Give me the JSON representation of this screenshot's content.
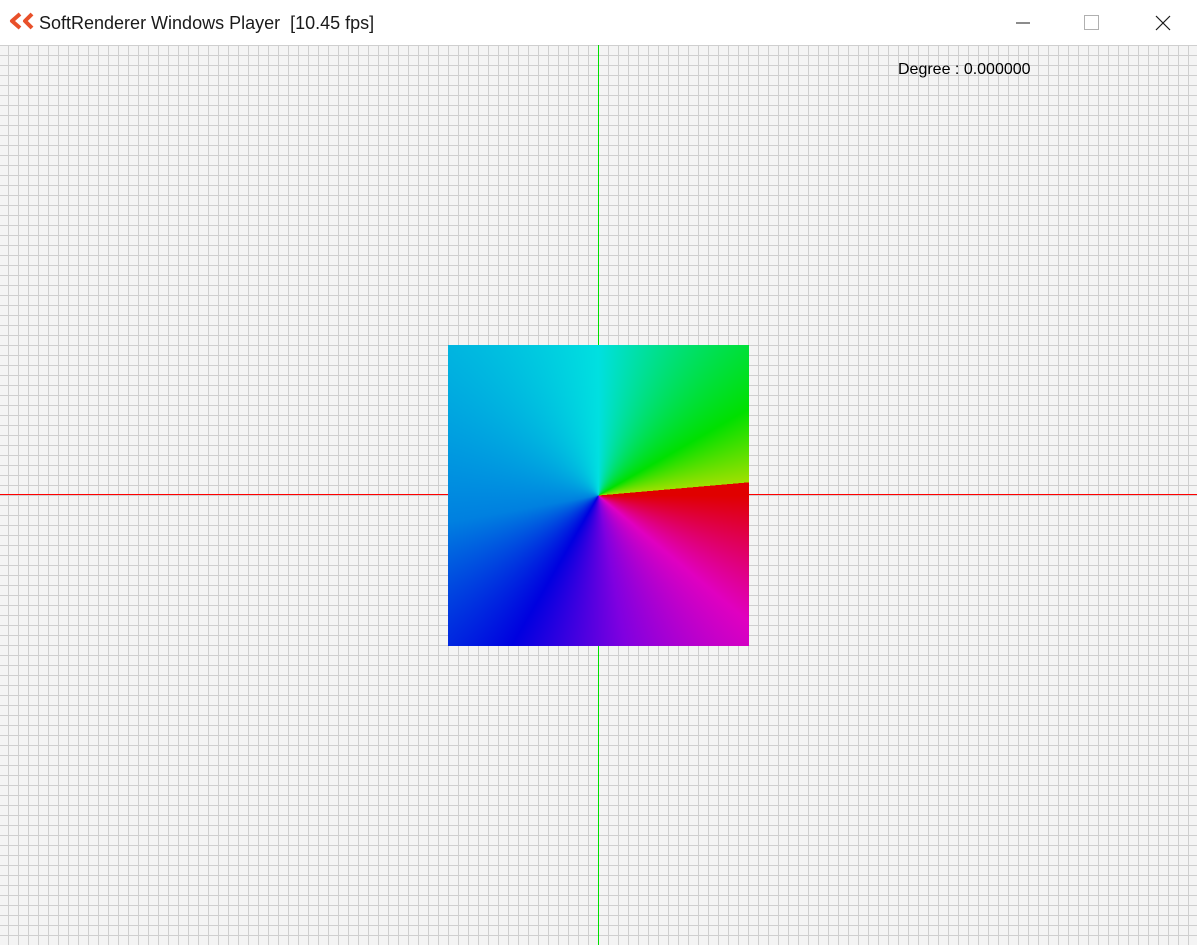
{
  "window": {
    "title": "SoftRenderer Windows Player  [10.45 fps]",
    "icon": "app-logo-icon",
    "caption_buttons": [
      {
        "name": "minimize",
        "icon": "minimize-icon"
      },
      {
        "name": "maximize",
        "icon": "maximize-icon"
      },
      {
        "name": "close",
        "icon": "close-icon"
      }
    ]
  },
  "viewport": {
    "degree_label": "Degree : 0.000000",
    "axis_colors": {
      "x": "#ff0000",
      "y": "#00e000"
    },
    "grid_color": "#cfcfcf",
    "background_color": "#f4f4f4"
  },
  "colors": {
    "icon_accent": "#e8502a"
  }
}
